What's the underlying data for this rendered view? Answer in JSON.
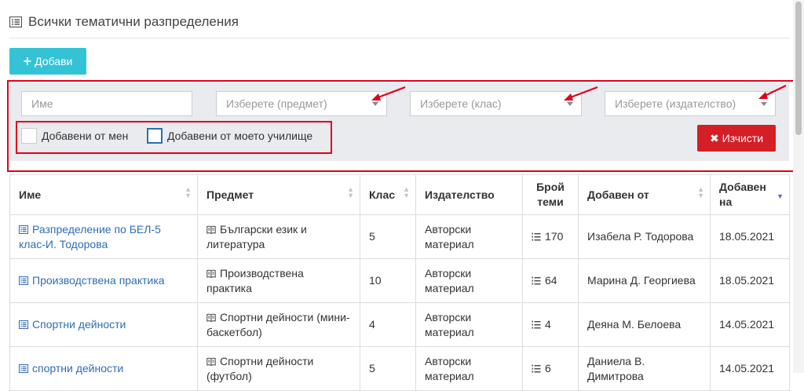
{
  "page": {
    "title": "Всички тематични разпределения"
  },
  "toolbar": {
    "add_label": "Добави"
  },
  "filters": {
    "name_placeholder": "Име",
    "subject_placeholder": "Изберете (предмет)",
    "class_placeholder": "Изберете (клас)",
    "publisher_placeholder": "Изберете (издателство)",
    "added_by_me": "Добавени от мен",
    "added_by_school": "Добавени от моето училище",
    "clear_label": "Изчисти"
  },
  "table": {
    "headers": [
      "Име",
      "Предмет",
      "Клас",
      "Издателство",
      "Брой теми",
      "Добавен от",
      "Добавен на"
    ],
    "rows": [
      {
        "name": "Разпределение по БЕЛ-5 клас-И. Тодорова",
        "subject": "Български език и литература",
        "class": "5",
        "publisher": "Авторски материал",
        "topics": "170",
        "added_by": "Изабела Р. Тодорова",
        "added_on": "18.05.2021"
      },
      {
        "name": "Производствена практика",
        "subject": "Производствена практика",
        "class": "10",
        "publisher": "Авторски материал",
        "topics": "64",
        "added_by": "Марина Д. Георгиева",
        "added_on": "18.05.2021"
      },
      {
        "name": "Спортни дейности",
        "subject": "Спортни дейности (мини-баскетбол)",
        "class": "4",
        "publisher": "Авторски материал",
        "topics": "4",
        "added_by": "Деяна М. Белоева",
        "added_on": "14.05.2021"
      },
      {
        "name": "спортни дейности",
        "subject": "Спортни дейности (футбол)",
        "class": "5",
        "publisher": "Авторски материал",
        "topics": "6",
        "added_by": "Даниела В. Димитрова",
        "added_on": "14.05.2021"
      }
    ]
  },
  "colors": {
    "accent": "#34c3d6",
    "danger": "#d41f26",
    "link": "#2f6db5",
    "annotation": "#e3001b"
  },
  "icons": {
    "header": "list-icon",
    "row": "list-icon",
    "subject": "book-icon",
    "topics": "list-ordered-icon"
  }
}
